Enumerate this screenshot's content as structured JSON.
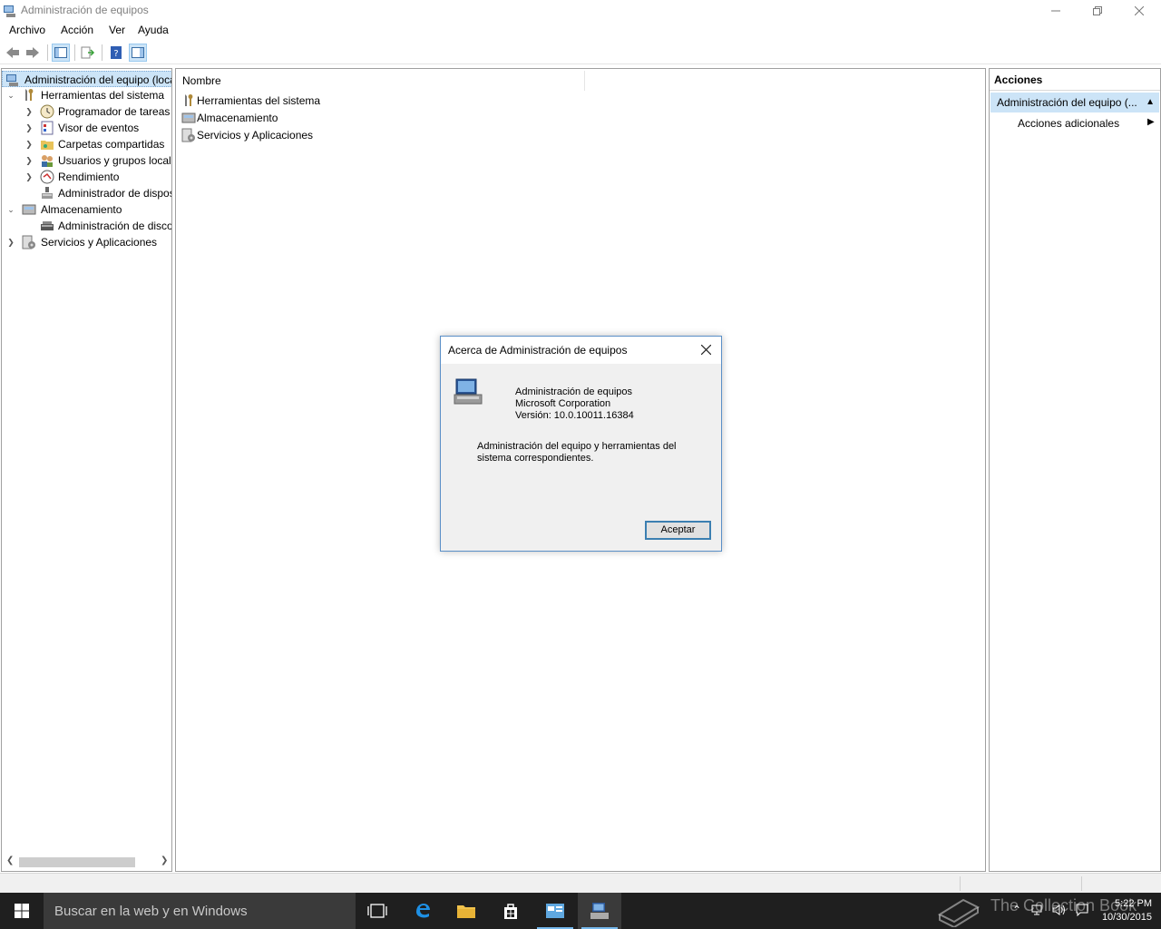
{
  "window": {
    "title": "Administración de equipos"
  },
  "menu": [
    "Archivo",
    "Acción",
    "Ver",
    "Ayuda"
  ],
  "tree": [
    {
      "label": "Administración del equipo (local)",
      "level": 0,
      "expander": "",
      "icon": "computer-management-icon"
    },
    {
      "label": "Herramientas del sistema",
      "level": 1,
      "expander": "expanded",
      "icon": "tools-icon"
    },
    {
      "label": "Programador de tareas",
      "level": 2,
      "expander": "collapsed",
      "icon": "clock-icon"
    },
    {
      "label": "Visor de eventos",
      "level": 2,
      "expander": "collapsed",
      "icon": "event-viewer-icon"
    },
    {
      "label": "Carpetas compartidas",
      "level": 2,
      "expander": "collapsed",
      "icon": "shared-folder-icon"
    },
    {
      "label": "Usuarios y grupos locales",
      "level": 2,
      "expander": "collapsed",
      "icon": "users-icon"
    },
    {
      "label": "Rendimiento",
      "level": 2,
      "expander": "collapsed",
      "icon": "performance-icon"
    },
    {
      "label": "Administrador de dispositivos",
      "level": 2,
      "expander": "",
      "icon": "device-manager-icon"
    },
    {
      "label": "Almacenamiento",
      "level": 1,
      "expander": "expanded",
      "icon": "storage-icon"
    },
    {
      "label": "Administración de discos",
      "level": 2,
      "expander": "",
      "icon": "disk-icon"
    },
    {
      "label": "Servicios y Aplicaciones",
      "level": 1,
      "expander": "collapsed",
      "icon": "services-icon"
    }
  ],
  "main": {
    "column_header": "Nombre",
    "items": [
      "Herramientas del sistema",
      "Almacenamiento",
      "Servicios y Aplicaciones"
    ]
  },
  "actions": {
    "header": "Acciones",
    "section": "Administración del equipo (...",
    "item": "Acciones adicionales"
  },
  "dialog": {
    "title": "Acerca de Administración de equipos",
    "product": "Administración de equipos",
    "company": "Microsoft Corporation",
    "version": "Versión: 10.0.10011.16384",
    "description": "Administración del equipo y herramientas del sistema correspondientes.",
    "ok_label": "Aceptar"
  },
  "taskbar": {
    "search_placeholder": "Buscar en la web y en Windows",
    "time": "5:22 PM",
    "date": "10/30/2015",
    "watermark": "The Collection Book"
  },
  "colors": {
    "selection": "#cce4f7",
    "dialog_border": "#5a8fc7",
    "taskbar": "#1f1f1f",
    "accent": "#76b9ed"
  }
}
